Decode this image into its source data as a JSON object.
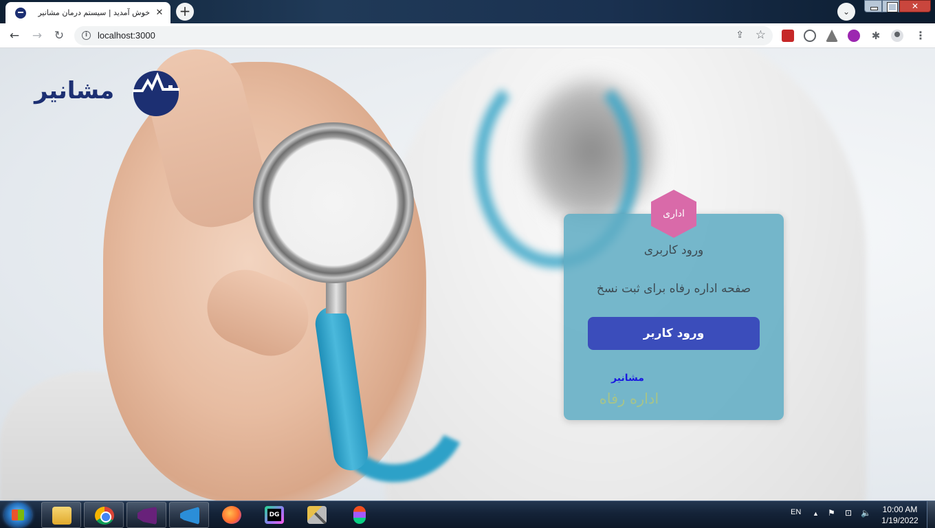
{
  "browser": {
    "tab_title": "خوش آمدید | سیستم درمان مشانیر",
    "tab_close": "✕",
    "new_tab": "+",
    "tab_search": "⌄",
    "window_close": "✕",
    "url": "localhost:3000",
    "nav_back": "←",
    "nav_forward": "→",
    "nav_reload": "↻",
    "info_icon": "i",
    "share_icon": "⇪",
    "star_icon": "☆",
    "extensions_icon": "✱",
    "menu_icon": "⋮"
  },
  "page": {
    "logo_text": "مشانیر",
    "badge": "اداری",
    "heading": "ورود کاربری",
    "description": "صفحه اداره رفاه برای ثبت نسخ",
    "login_button": "ورود کاربر",
    "brand": "مشانیر",
    "subtitle": "اداره رفاه",
    "colors": {
      "brand": "#1c2f72",
      "card": "#60acc4",
      "badge": "#d96aa9",
      "button": "#3b4dbb"
    }
  },
  "taskbar": {
    "apps": [
      {
        "icon": "file-explorer-icon"
      },
      {
        "icon": "chrome-icon"
      },
      {
        "icon": "visual-studio-icon"
      },
      {
        "icon": "vscode-icon"
      },
      {
        "icon": "firefox-icon"
      },
      {
        "icon": "datagrip-icon"
      },
      {
        "icon": "tools-icon"
      },
      {
        "icon": "figma-icon"
      }
    ],
    "language": "EN",
    "tray_arrow": "▲",
    "flag_icon": "⚑",
    "network_icon": "⊡",
    "volume_icon": "🔈",
    "time": "10:00 AM",
    "date": "1/19/2022"
  }
}
